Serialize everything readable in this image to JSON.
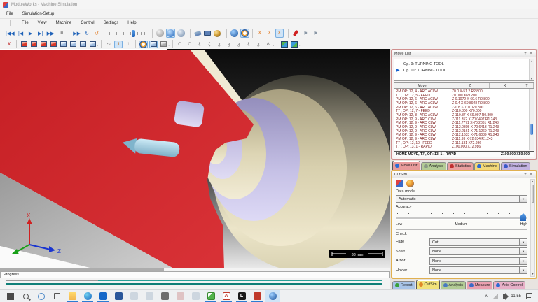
{
  "window": {
    "title": "ModuleWorks - Machine Simulation"
  },
  "menubar_top": [
    "File",
    "Simulation-Setup"
  ],
  "menubar_main": [
    "File",
    "View",
    "Machine",
    "Control",
    "Settings",
    "Help"
  ],
  "toolbar_sim": [
    {
      "n": "go-to-start-button",
      "g": "|◀◀"
    },
    {
      "n": "step-back-button",
      "g": "|◀"
    },
    {
      "n": "play-button",
      "g": "▶"
    },
    {
      "n": "step-forward-button",
      "g": "▶|"
    },
    {
      "n": "go-to-end-button",
      "g": "▶▶|"
    },
    {
      "n": "stop-button",
      "g": "■",
      "c": "#9a9a9a"
    },
    {
      "t": "sep"
    },
    {
      "n": "fast-forward-button",
      "g": "▶▶"
    },
    {
      "n": "loop-button",
      "g": "↻"
    },
    {
      "n": "refresh-button",
      "g": "↺",
      "c": "#e07820"
    },
    {
      "t": "sep"
    },
    {
      "t": "slider",
      "n": "speed-slider"
    },
    {
      "t": "sep"
    },
    {
      "t": "shape",
      "n": "render-sphere-icon",
      "s": "circ circ-gray"
    },
    {
      "t": "shape",
      "n": "render-shaded-icon",
      "s": "circ circ-blue",
      "sel": true
    },
    {
      "t": "shape",
      "n": "render-wire-icon",
      "s": "circ circ-steel"
    },
    {
      "t": "dot"
    },
    {
      "t": "sep"
    },
    {
      "t": "shape",
      "n": "tag-tool-icon",
      "s": "tag"
    },
    {
      "t": "shape",
      "n": "label-tool-icon",
      "s": "card"
    },
    {
      "t": "shape",
      "n": "wrench-tool-icon",
      "s": "tools"
    },
    {
      "t": "dot"
    },
    {
      "t": "sep"
    },
    {
      "t": "shape",
      "n": "globe-view-icon",
      "s": "circ circ-blue2"
    },
    {
      "t": "shape",
      "n": "target-ring-icon",
      "s": "circ circ-ring",
      "sel": true
    },
    {
      "t": "sep"
    },
    {
      "n": "collision-check-1-button",
      "g": "X",
      "c": "#e07820"
    },
    {
      "n": "collision-check-2-button",
      "g": "X",
      "c": "#e07820"
    },
    {
      "n": "collision-check-3-button",
      "g": "X",
      "c": "#e07820",
      "sel": true
    },
    {
      "t": "dot"
    },
    {
      "t": "sep"
    },
    {
      "t": "shape",
      "n": "pin-marker-icon",
      "s": "pinr"
    },
    {
      "n": "flag-1-button",
      "g": "⚑",
      "c": "#8a97a6"
    },
    {
      "n": "flag-2-button",
      "g": "⚑",
      "c": "#8a97a6"
    },
    {
      "t": "dot"
    }
  ],
  "toolbar_view": [
    {
      "n": "fit-view-button",
      "g": "✗",
      "c": "#c03030"
    },
    {
      "t": "sep"
    },
    {
      "t": "shape",
      "n": "view-cube-front-icon",
      "s": "cube cube-red"
    },
    {
      "t": "shape",
      "n": "view-cube-back-icon",
      "s": "cube cube-red"
    },
    {
      "t": "shape",
      "n": "view-cube-left-icon",
      "s": "cube cube-red"
    },
    {
      "t": "shape",
      "n": "view-cube-right-icon",
      "s": "cube cube-red"
    },
    {
      "t": "shape",
      "n": "view-cube-top-icon",
      "s": "cube cube-blue"
    },
    {
      "t": "shape",
      "n": "view-cube-bottom-icon",
      "s": "cube cube-blue"
    },
    {
      "t": "shape",
      "n": "view-cube-iso-icon",
      "s": "cube cube-blue"
    },
    {
      "t": "shape",
      "n": "view-cube-iso2-icon",
      "s": "cube cube-blue"
    },
    {
      "t": "dot"
    },
    {
      "t": "sep"
    },
    {
      "n": "toolpath-trace-button",
      "g": "∿",
      "c": "#555"
    },
    {
      "n": "tool-display-button",
      "g": "1",
      "c": "#c07020",
      "sel": true
    },
    {
      "n": "tool-ghost-button",
      "g": "1",
      "c": "#bbbbbb"
    },
    {
      "t": "sep"
    },
    {
      "t": "shape",
      "n": "stock-sphere-icon",
      "s": "circ circ-ring",
      "sel": true
    },
    {
      "t": "shape",
      "n": "stock-cube-icon",
      "s": "cube cube-blue",
      "sel": true
    },
    {
      "t": "shape",
      "n": "fixture-cube-icon",
      "s": "cube cube-gray"
    },
    {
      "t": "dot"
    },
    {
      "t": "sep"
    },
    {
      "n": "geometry-circle-button",
      "g": "O",
      "c": "#666"
    },
    {
      "n": "geometry-circle2-button",
      "g": "O",
      "c": "#666"
    },
    {
      "n": "geometry-curve1-button",
      "g": "ζ",
      "c": "#666"
    },
    {
      "n": "geometry-curve2-button",
      "g": "ζ",
      "c": "#666"
    },
    {
      "n": "geometry-curve3-button",
      "g": "ʒ",
      "c": "#666"
    },
    {
      "n": "geometry-curve4-button",
      "g": "ʒ",
      "c": "#666"
    },
    {
      "n": "geometry-curve5-button",
      "g": "ʒ",
      "c": "#666"
    },
    {
      "n": "geometry-curve6-button",
      "g": "ζ",
      "c": "#666"
    },
    {
      "n": "geometry-curve7-button",
      "g": "ʒ",
      "c": "#666"
    },
    {
      "n": "geometry-poly-button",
      "g": "Δ",
      "c": "#666"
    },
    {
      "t": "dot"
    },
    {
      "t": "sep"
    },
    {
      "t": "shape",
      "n": "terrain-add-icon",
      "s": "terr terr-a"
    },
    {
      "t": "shape",
      "n": "terrain-view-icon",
      "s": "terr terr-b"
    },
    {
      "t": "dot"
    }
  ],
  "move_list": {
    "title": "Move List",
    "pin_glyph": "+",
    "close_glyph": "×",
    "operations": [
      {
        "label": "Op. 9: TURNING TOOL",
        "active": false
      },
      {
        "label": "Op. 10: TURNING TOOL",
        "active": true
      }
    ],
    "columns": [
      "Move",
      "Z",
      "X",
      "T"
    ],
    "rows": [
      {
        "move": "PM OP: 12, 4 - ARC ACLW",
        "values": "Z0.0 X-51.2 R2.800"
      },
      {
        "move": "T7 , OP: 12, 5 - FEED",
        "values": "Z0.000 X69.200"
      },
      {
        "move": "PM OP: 12, 6 - ARC ACLW",
        "values": "Z-0.1072 X-69.6 R0.800"
      },
      {
        "move": "PM OP: 12, 6 - ARC ACLW",
        "values": "Z-0.4 X-69.8928 R0.800"
      },
      {
        "move": "PM OP: 12, 6 - ARC ACLW",
        "values": "Z-0.8 X-70.0 R0.800"
      },
      {
        "move": "T7 , OP: 12, 7 - FEED",
        "values": "Z-110.800 X70.000"
      },
      {
        "move": "PM OP: 12, 8 - ARC ACLW",
        "values": "Z-110.87 X-69.997 R0.800"
      },
      {
        "move": "PM OP: 12, 9 - ARC CLW",
        "values": "Z-111.352 X-70.0497 R1.243"
      },
      {
        "move": "PM OP: 12, 9 - ARC CLW",
        "values": "Z-111.7771 X-70.2831 R1.243"
      },
      {
        "move": "PM OP: 12, 9 - ARC CLW",
        "values": "Z-112.0805 X-70.6413 R1.243"
      },
      {
        "move": "PM OP: 12, 9 - ARC CLW",
        "values": "Z-112.2161 X-71.1269 R1.243"
      },
      {
        "move": "PM OP: 12, 9 - ARC CLW",
        "values": "Z-112.1633 X-71.6089 R1.243"
      },
      {
        "move": "PM OP: 12, 9 - ARC CLW",
        "values": "Z-111.93 X-72.034 R1.243"
      },
      {
        "move": "T7 , OP: 12, 10 - FEED",
        "values": "Z-111.131 X72.986"
      },
      {
        "move": "T7 , OP: 13, 1 - RAPID",
        "values": "Z100.000 X72.986"
      }
    ],
    "home_row": {
      "label": "HOME MOVE, T7 , OP: 13, 1 -  RAPID",
      "values": "Z100.000 X50.000"
    }
  },
  "panel_tabs": [
    {
      "label": "Move List",
      "color": "#e89b9b",
      "icon_color": "#2b6bd4",
      "selected": true
    },
    {
      "label": "Analysis",
      "color": "#b3cc96",
      "icon_color": "#8a9a84",
      "selected": false
    },
    {
      "label": "Statistics",
      "color": "#eaa0a0",
      "icon_color": "#c03030",
      "selected": false
    },
    {
      "label": "Machine",
      "color": "#f2d878",
      "icon_color": "#2b6bd4",
      "selected": false
    },
    {
      "label": "Simulation",
      "color": "#c3b3e2",
      "icon_color": "#3a58c8",
      "selected": false
    }
  ],
  "cutsim": {
    "title": "CutSim",
    "pin_glyph": "+",
    "close_glyph": "×",
    "data_model_label": "Data model",
    "data_model_value": "Automatic",
    "accuracy_label": "Accuracy",
    "slider_labels": [
      "Low",
      "Medium",
      "High"
    ],
    "check_label": "Check",
    "check_rows": [
      {
        "label": "Flute",
        "value": "Cut"
      },
      {
        "label": "Shaft",
        "value": "None"
      },
      {
        "label": "Arbor",
        "value": "None"
      },
      {
        "label": "Holder",
        "value": "None"
      }
    ]
  },
  "bottom_tabs": [
    {
      "label": "Report",
      "color": "#a8c4e8",
      "icon_color": "#3aa03a",
      "selected": false
    },
    {
      "label": "CutSim",
      "color": "#f2e27a",
      "icon_color": "#e08828",
      "selected": true
    },
    {
      "label": "Analysis",
      "color": "#b3cc96",
      "icon_color": "#4a7ac0",
      "selected": false
    },
    {
      "label": "Measure",
      "color": "#eaa0b0",
      "icon_color": "#3a6ac8",
      "selected": false
    },
    {
      "label": "Axis Control",
      "color": "#e8b0c8",
      "icon_color": "#2b6bd4",
      "selected": false
    }
  ],
  "viewport": {
    "scale_label": "38 mm",
    "axis_x_label": "X",
    "axis_z_label": "Z",
    "colors": {
      "section_red": "#cf2127",
      "stock_cream": "#cfc8a8",
      "cut_lavender": "#c6c1e6",
      "tool_blue": "#a8d8ec",
      "floor_gray": "#a8a8a8"
    }
  },
  "progress": {
    "label": "Progress"
  },
  "taskbar": {
    "clock": "11:55",
    "items": [
      {
        "name": "start-button",
        "cls": "ic-start"
      },
      {
        "name": "search-button",
        "cls": "ic-search"
      },
      {
        "name": "cortana-button",
        "cls": "ic-cortana"
      },
      {
        "name": "task-view-button",
        "cls": "ic-taskview"
      },
      {
        "name": "file-explorer-icon",
        "cls": "ic-folder",
        "underline": true
      },
      {
        "name": "edge-icon",
        "cls": "ic-edge",
        "underline": true
      },
      {
        "name": "outlook-icon",
        "cls": "ic-outlook",
        "underline": true
      },
      {
        "name": "word-icon",
        "cls": "ic-word"
      },
      {
        "name": "app-dim-1-icon",
        "cls": "ic-dimapp",
        "dim": true
      },
      {
        "name": "app-dim-2-icon",
        "cls": "ic-dimapp",
        "dim": true
      },
      {
        "name": "calculator-icon",
        "cls": "ic-calc"
      },
      {
        "name": "app-dim-red-icon",
        "cls": "ic-dimred",
        "dim": true
      },
      {
        "name": "app-dim-3-icon",
        "cls": "ic-dimapp",
        "dim": true
      },
      {
        "name": "nx-icon",
        "cls": "ic-nx",
        "underline": true
      },
      {
        "name": "autocad-icon",
        "cls": "ic-acad",
        "underline": true,
        "glyph": "A"
      },
      {
        "name": "l-app-icon",
        "cls": "ic-lapp",
        "underline": true,
        "glyph": "L"
      },
      {
        "name": "red-app-icon",
        "cls": "ic-redapp",
        "underline": true
      },
      {
        "name": "moduleworks-icon",
        "cls": "ic-mw",
        "active": true
      }
    ]
  }
}
